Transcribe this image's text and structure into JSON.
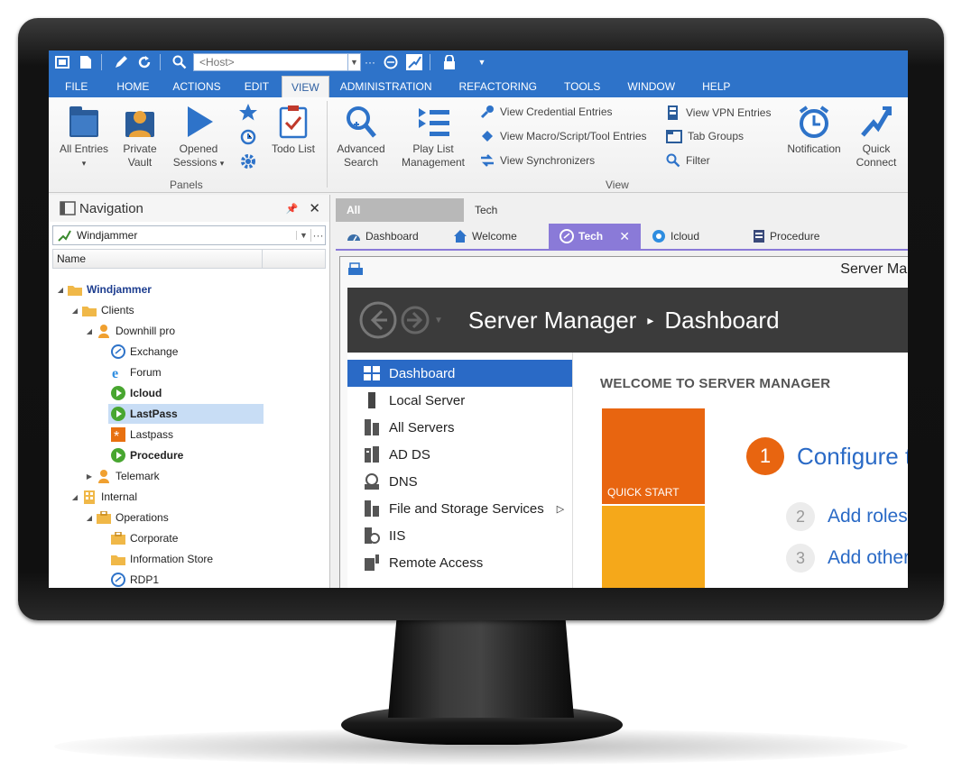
{
  "toolbar": {
    "host_placeholder": "<Host>"
  },
  "menu": {
    "tabs": [
      "FILE",
      "HOME",
      "ACTIONS",
      "EDIT",
      "VIEW",
      "ADMINISTRATION",
      "REFACTORING",
      "TOOLS",
      "WINDOW",
      "HELP"
    ],
    "active": "VIEW"
  },
  "ribbon": {
    "all_entries": "All Entries",
    "private_vault_1": "Private",
    "private_vault_2": "Vault",
    "opened_sessions_1": "Opened",
    "opened_sessions_2": "Sessions",
    "todo_list": "Todo List",
    "advanced_search_1": "Advanced",
    "advanced_search_2": "Search",
    "play_list_1": "Play List",
    "play_list_2": "Management",
    "view_credential": "View Credential Entries",
    "view_macro": "View Macro/Script/Tool Entries",
    "view_sync": "View Synchronizers",
    "view_vpn": "View VPN Entries",
    "tab_groups": "Tab Groups",
    "filter": "Filter",
    "notification": "Notification",
    "quick_connect_1": "Quick",
    "quick_connect_2": "Connect",
    "group_panels": "Panels",
    "group_view": "View"
  },
  "navigation": {
    "title": "Navigation",
    "datasource": "Windjammer",
    "column_name": "Name",
    "tree": [
      {
        "label": "Windjammer",
        "icon": "folder-icon"
      },
      {
        "label": "Clients",
        "icon": "folder-icon"
      },
      {
        "label": "Downhill pro",
        "icon": "user-icon"
      },
      {
        "label": "Exchange",
        "icon": "rdp-icon"
      },
      {
        "label": "Forum",
        "icon": "ie-icon"
      },
      {
        "label": "Icloud",
        "icon": "play-icon"
      },
      {
        "label": "LastPass",
        "icon": "play-icon"
      },
      {
        "label": "Lastpass",
        "icon": "asterisk-icon"
      },
      {
        "label": "Procedure",
        "icon": "play-icon"
      },
      {
        "label": "Telemark",
        "icon": "user-icon"
      },
      {
        "label": "Internal",
        "icon": "building-icon"
      },
      {
        "label": "Operations",
        "icon": "briefcase-icon"
      },
      {
        "label": "Corporate",
        "icon": "briefcase-icon"
      },
      {
        "label": "Information Store",
        "icon": "folder-icon"
      },
      {
        "label": "RDP1",
        "icon": "rdp-icon"
      }
    ]
  },
  "document": {
    "group_tabs": [
      "All",
      "Tech"
    ],
    "tabs": [
      "Dashboard",
      "Welcome",
      "Tech",
      "Icloud",
      "Procedure"
    ],
    "active_tab": "Tech"
  },
  "server_manager": {
    "window_title": "Server Man",
    "breadcrumb_root": "Server Manager",
    "breadcrumb_page": "Dashboard",
    "sidebar": [
      "Dashboard",
      "Local Server",
      "All Servers",
      "AD DS",
      "DNS",
      "File and Storage Services",
      "IIS",
      "Remote Access"
    ],
    "welcome": "WELCOME TO SERVER MANAGER",
    "quick_start": "QUICK START",
    "steps": [
      {
        "num": "1",
        "text": "Configure t"
      },
      {
        "num": "2",
        "text": "Add roles"
      },
      {
        "num": "3",
        "text": "Add other"
      }
    ]
  },
  "colors": {
    "accent": "#2e73c9",
    "tab_active": "#8a7ad8",
    "quick_start": "#e86510",
    "whats_new": "#f5a81a"
  }
}
